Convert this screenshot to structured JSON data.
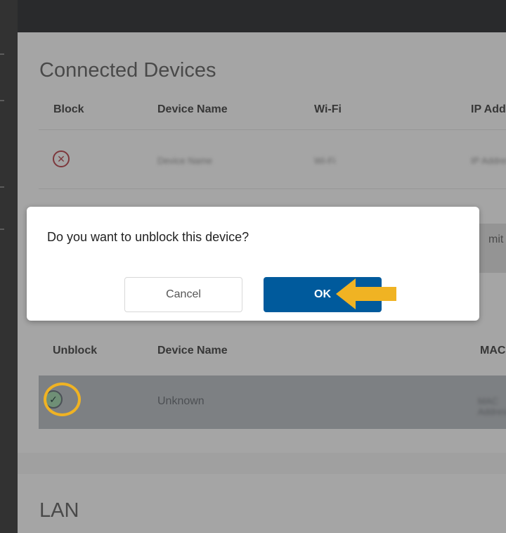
{
  "connected_devices": {
    "title": "Connected Devices",
    "columns": [
      "Block",
      "Device Name",
      "Wi-Fi",
      "IP Add"
    ],
    "row": {
      "device_name": "Device Name",
      "wifi": "Wi-Fi",
      "ip": "IP Address"
    },
    "limit_text": "mit"
  },
  "blocked_devices": {
    "columns": [
      "Unblock",
      "Device Name",
      "MAC"
    ],
    "row": {
      "device_name": "Unknown",
      "mac": "MAC Address"
    }
  },
  "lan": {
    "title": "LAN"
  },
  "dialog": {
    "message": "Do you want to unblock this device?",
    "cancel_label": "Cancel",
    "ok_label": "OK"
  },
  "colors": {
    "primary": "#005a9c",
    "highlight": "#f0b323",
    "block_icon": "#b3343c"
  },
  "icons": {
    "block": "x-circle-icon",
    "unblock": "check-circle-icon",
    "pointer": "arrow-left-icon"
  }
}
